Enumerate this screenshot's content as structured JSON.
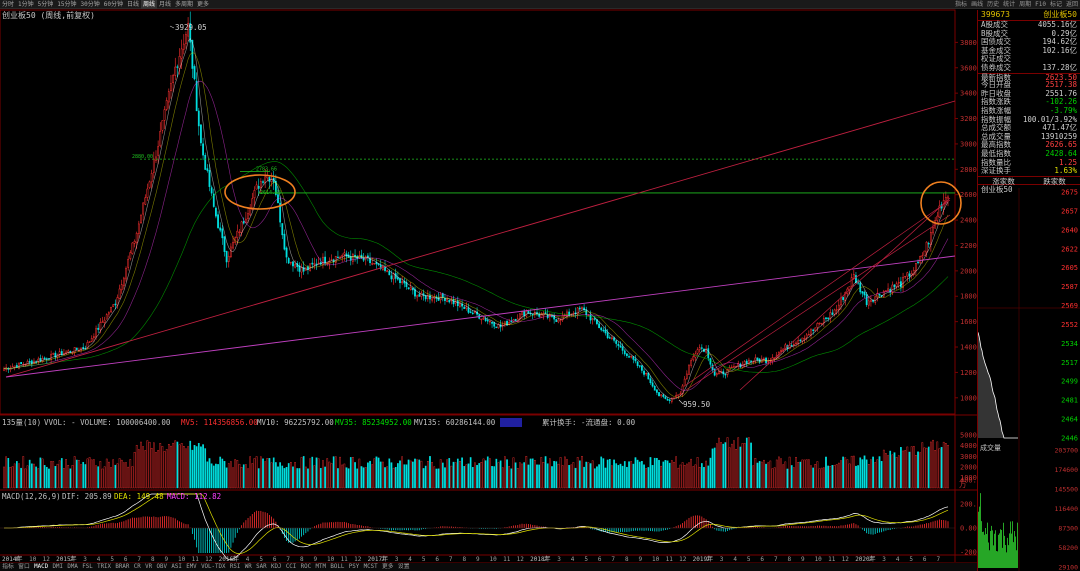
{
  "toolbar": {
    "periods": [
      "分时",
      "1分钟",
      "5分钟",
      "15分钟",
      "30分钟",
      "60分钟",
      "日线",
      "周线",
      "月线",
      "多周期",
      "更多"
    ],
    "active_period": 7,
    "right_buttons": [
      "指标",
      "画线",
      "历史",
      "统计",
      "周期",
      "F10",
      "标记",
      "返回"
    ]
  },
  "chart": {
    "title": "创业板50 (周线,前复权)",
    "y_axis_labels": [
      "3800",
      "3600",
      "3400",
      "3200",
      "3000",
      "2800",
      "2600",
      "2400",
      "2200",
      "2000",
      "1800",
      "1600",
      "1400",
      "1200",
      "1000"
    ],
    "annotations": {
      "high_label": "3929.05",
      "low_label": "959.50",
      "level_2880": "2880.00",
      "level_2783": "2783.66",
      "level_2614": "2614.63"
    }
  },
  "volume_panel": {
    "name": "135量(10)",
    "vvol": "VVOL: - VOLUME: 100006400.00",
    "mv5": "MV5: 114356856.00",
    "mv10": "MV10: 96225792.00",
    "mv35": "MV35: 85234952.00",
    "mv135": "MV135: 60286144.00",
    "cum_turnover": "累计换手: -流通盘: 0.00",
    "y_labels": [
      "5000",
      "4000",
      "3000",
      "2000",
      "1000"
    ],
    "unit": "万"
  },
  "macd_panel": {
    "name": "MACD(12,26,9)",
    "dif": "DIF: 205.89",
    "dea": "DEA: 149.48",
    "macd": "MACD: 112.82",
    "y_labels": [
      "400.0",
      "200.0",
      "0.00",
      "-200.0"
    ]
  },
  "x_axis_labels": [
    "2014年",
    "8",
    "10",
    "12",
    "2015年",
    "2",
    "3",
    "4",
    "5",
    "6",
    "7",
    "8",
    "9",
    "10",
    "11",
    "12",
    "2016年",
    "3",
    "4",
    "5",
    "6",
    "7",
    "8",
    "9",
    "10",
    "11",
    "12",
    "2017年",
    "2",
    "3",
    "4",
    "5",
    "6",
    "7",
    "8",
    "9",
    "10",
    "11",
    "12",
    "2018年",
    "2",
    "3",
    "4",
    "5",
    "6",
    "7",
    "8",
    "9",
    "10",
    "11",
    "12",
    "2019年",
    "2",
    "3",
    "4",
    "5",
    "6",
    "7",
    "8",
    "9",
    "10",
    "11",
    "12",
    "2020年",
    "2",
    "3",
    "4",
    "5",
    "6",
    "7"
  ],
  "bottom_tabs": [
    "指标",
    "窗口",
    "MACD",
    "DMI",
    "DMA",
    "FSL",
    "TRIX",
    "BRAR",
    "CR",
    "VR",
    "OBV",
    "ASI",
    "EMV",
    "VOL-TDX",
    "RSI",
    "WR",
    "SAR",
    "KDJ",
    "CCI",
    "ROC",
    "MTM",
    "BOLL",
    "PSY",
    "MCST",
    "更多",
    "设置"
  ],
  "panel": {
    "code": "399673",
    "name": "创业板50",
    "rows": [
      {
        "label": "A股成交",
        "value": "4055.16亿",
        "color": "normal"
      },
      {
        "label": "B股成交",
        "value": "0.29亿",
        "color": "normal"
      },
      {
        "label": "国债成交",
        "value": "194.62亿",
        "color": "normal"
      },
      {
        "label": "基金成交",
        "value": "102.16亿",
        "color": "normal"
      },
      {
        "label": "权证成交",
        "value": "",
        "color": "normal"
      },
      {
        "label": "债券成交",
        "value": "137.28亿",
        "color": "normal"
      },
      {
        "label": "最新指数",
        "value": "2623.50",
        "color": "red"
      },
      {
        "label": "今日开盘",
        "value": "2517.38",
        "color": "red"
      },
      {
        "label": "昨日收盘",
        "value": "2551.76",
        "color": "normal"
      },
      {
        "label": "指数涨跌",
        "value": "-102.26",
        "color": "green"
      },
      {
        "label": "指数涨幅",
        "value": "-3.79%",
        "color": "green"
      },
      {
        "label": "指数振幅",
        "value": "100.01/3.92%",
        "color": "normal"
      },
      {
        "label": "总成交额",
        "value": "471.47亿",
        "color": "normal"
      },
      {
        "label": "总成交量",
        "value": "13910259",
        "color": "normal"
      },
      {
        "label": "最高指数",
        "value": "2626.65",
        "color": "red"
      },
      {
        "label": "最低指数",
        "value": "2428.64",
        "color": "green"
      },
      {
        "label": "指数量比",
        "value": "1.25",
        "color": "red"
      },
      {
        "label": "深证换手",
        "value": "1.63%",
        "color": "yellow"
      }
    ],
    "tabs": [
      "涨家数",
      "跌家数"
    ],
    "mini_title": "创业板50",
    "mini_price_labels": [
      "2675",
      "2657",
      "2640",
      "2622",
      "2605",
      "2587",
      "2569",
      "2552",
      "2534",
      "2517",
      "2499",
      "2481",
      "2464",
      "2446"
    ],
    "mini_vol_labels": [
      "203700",
      "174600",
      "145500",
      "116400",
      "87300",
      "58200",
      "29100"
    ],
    "mini_vol_title": "成交量"
  },
  "colors": {
    "up": "#ff3030",
    "down": "#00e0e0",
    "ma_white": "#ffffff",
    "ma_yellow": "#e0e000",
    "ma_magenta": "#ff40ff",
    "ma_green": "#00ff00",
    "trendline_red": "#c02040",
    "trendline_purple": "#c040c0",
    "circle": "#f08020",
    "level_green": "#20c020"
  }
}
